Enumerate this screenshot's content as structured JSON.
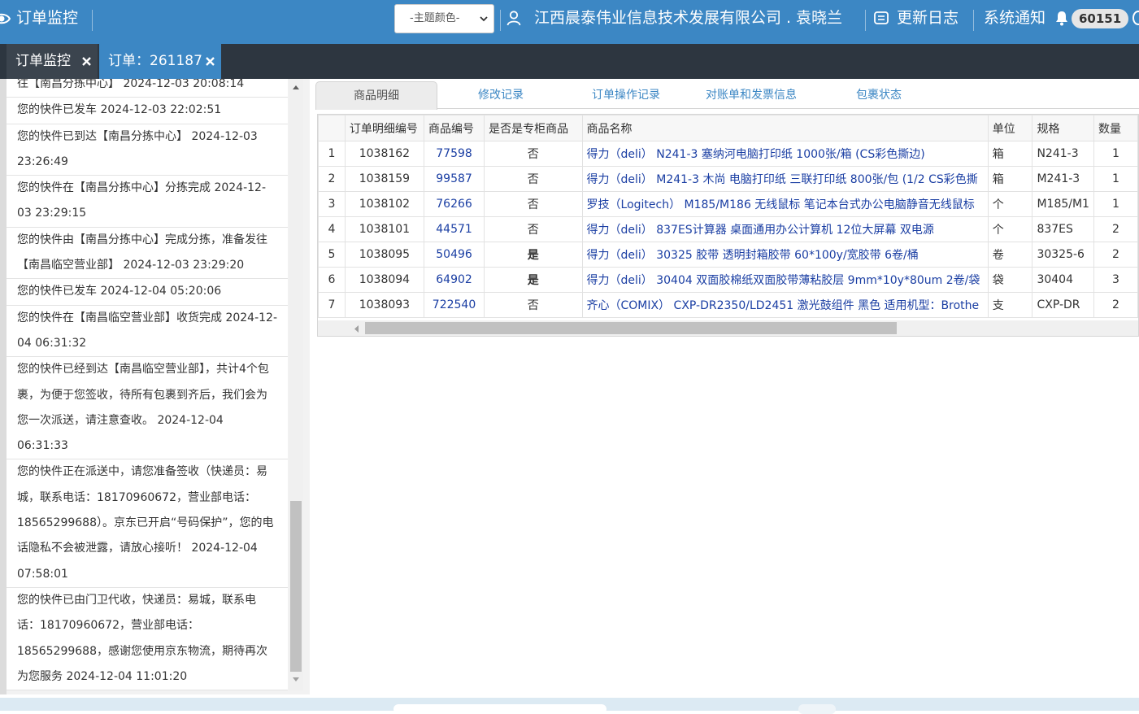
{
  "header": {
    "title": "订单监控",
    "theme_select": "-主题颜色-",
    "company_user": "江西晨泰伟业信息技术发展有限公司 . 袁晓兰",
    "update_log": "更新日志",
    "system_notice": "系统通知",
    "notice_count": "60151"
  },
  "tabs": [
    {
      "label": "订单监控"
    },
    {
      "label": "订单：261187"
    }
  ],
  "tracking": [
    "往【南昌分拣中心】 2024-12-03 20:08:14",
    "您的快件已发车 2024-12-03 22:02:51",
    "您的快件已到达【南昌分拣中心】 2024-12-03 23:26:49",
    "您的快件在【南昌分拣中心】分拣完成 2024-12-03 23:29:15",
    "您的快件由【南昌分拣中心】完成分拣，准备发往【南昌临空营业部】 2024-12-03 23:29:20",
    "您的快件已发车 2024-12-04 05:20:06",
    "您的快件在【南昌临空营业部】收货完成 2024-12-04 06:31:32",
    "您的快件已经到达【南昌临空营业部】，共计4个包裹，为便于您签收，待所有包裹到齐后，我们会为您一次派送，请注意查收。 2024-12-04 06:31:33",
    "您的快件正在派送中，请您准备签收（快递员：易城，联系电话：18170960672，营业部电话：18565299688）。京东已开启“号码保护”，您的电话隐私不会被泄露，请放心接听！ 2024-12-04 07:58:01",
    "您的快件已由门卫代收，快递员：易城，联系电话：18170960672，营业部电话：18565299688，感谢您使用京东物流，期待再次为您服务 2024-12-04 11:01:20"
  ],
  "detail_tabs": [
    {
      "label": "商品明细"
    },
    {
      "label": "修改记录"
    },
    {
      "label": "订单操作记录"
    },
    {
      "label": "对账单和发票信息"
    },
    {
      "label": "包裹状态"
    }
  ],
  "columns": [
    "订单明细编号",
    "商品编号",
    "是否是专柜商品",
    "商品名称",
    "单位",
    "规格",
    "数量"
  ],
  "rows": [
    {
      "idx": "1",
      "detail_no": "1038162",
      "product_no": "77598",
      "counter": "否",
      "name": "得力（deli）  N241-3 塞纳河电脑打印纸 1000张/箱 (CS彩色撕边)",
      "unit": "箱",
      "spec": "N241-3",
      "qty": "1"
    },
    {
      "idx": "2",
      "detail_no": "1038159",
      "product_no": "99587",
      "counter": "否",
      "name": "得力（deli）  M241-3 木尚 电脑打印纸 三联打印纸 800张/包 (1/2 CS彩色撕",
      "unit": "箱",
      "spec": "M241-3",
      "qty": "1"
    },
    {
      "idx": "3",
      "detail_no": "1038102",
      "product_no": "76266",
      "counter": "否",
      "name": "罗技（Logitech）  M185/M186 无线鼠标 笔记本台式办公电脑静音无线鼠标",
      "unit": "个",
      "spec": "M185/M1",
      "qty": "1"
    },
    {
      "idx": "4",
      "detail_no": "1038101",
      "product_no": "44571",
      "counter": "否",
      "name": "得力（deli）  837ES计算器 桌面通用办公计算机 12位大屏幕 双电源",
      "unit": "个",
      "spec": "837ES",
      "qty": "2"
    },
    {
      "idx": "5",
      "detail_no": "1038095",
      "product_no": "50496",
      "counter": "是",
      "name": "得力（deli）  30325 胶带 透明封箱胶带 60*100y/宽胶带 6卷/桶",
      "unit": "卷",
      "spec": "30325-6",
      "qty": "2"
    },
    {
      "idx": "6",
      "detail_no": "1038094",
      "product_no": "64902",
      "counter": "是",
      "name": "得力（deli）  30404 双面胶棉纸双面胶带薄粘胶层 9mm*10y*80um 2卷/袋",
      "unit": "袋",
      "spec": "30404",
      "qty": "3"
    },
    {
      "idx": "7",
      "detail_no": "1038093",
      "product_no": "722540",
      "counter": "否",
      "name": "齐心（COMIX）  CXP-DR2350/LD2451 激光鼓组件 黑色 适用机型：Brothe",
      "unit": "支",
      "spec": "CXP-DR",
      "qty": "2"
    }
  ]
}
